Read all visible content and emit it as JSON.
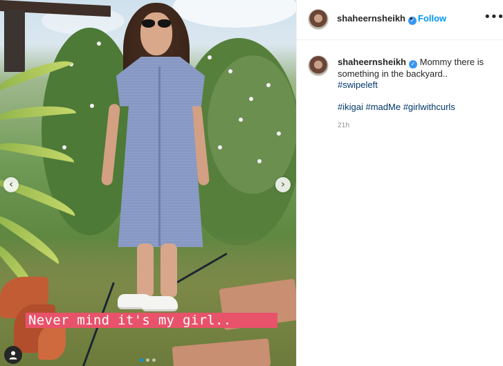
{
  "post": {
    "photo_alt": "",
    "caption_overlay": "Never mind it's my girl..",
    "carousel": {
      "prev_icon": "chevron-left-icon",
      "next_icon": "chevron-right-icon",
      "dot_count": 3,
      "active_index": 0
    },
    "tag_icon": "user-icon"
  },
  "header": {
    "username": "shaheernsheikh",
    "verified_glyph": "✓",
    "separator": "•",
    "follow_label": "Follow",
    "more_label": "•••"
  },
  "caption": {
    "username": "shaheernsheikh",
    "verified_glyph": "✓",
    "text_part1": "Mommy there is",
    "text_part2": "something in the backyard..",
    "hashtag_line1": "#swipeleft",
    "hashtags": [
      "#ikigai",
      "#madMe",
      "#girlwithcurls"
    ],
    "timestamp": "21h"
  },
  "colors": {
    "accent": "#0095f6",
    "banner": "#e8526a",
    "hashtag": "#00376b",
    "verified": "#3897f0"
  }
}
